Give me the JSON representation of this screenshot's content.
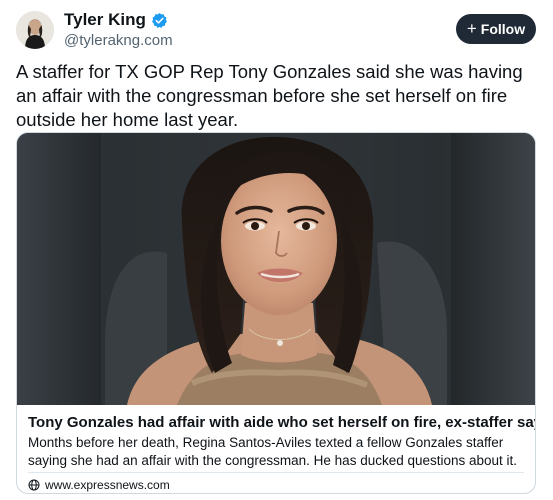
{
  "author": {
    "name": "Tyler King",
    "handle": "@tylerakng.com",
    "verified_icon": "verified-badge-icon",
    "verified_color": "#1d9bf0"
  },
  "follow": {
    "label": "Follow",
    "icon": "plus-icon",
    "background": "#1f2a36"
  },
  "post": {
    "text": "A staffer for TX GOP Rep Tony Gonzales said she was having an affair with the congressman before she set herself on fire outside her home last year."
  },
  "card": {
    "image_icon": "portrait-photo",
    "title": "Tony Gonzales had affair with aide who set herself on fire, ex-staffer says",
    "description": "Months before her death, Regina Santos-Aviles texted a fellow Gonzales staffer saying she had an affair with the congressman. He has ducked questions about it.",
    "source_icon": "globe-icon",
    "source": "www.expressnews.com"
  }
}
